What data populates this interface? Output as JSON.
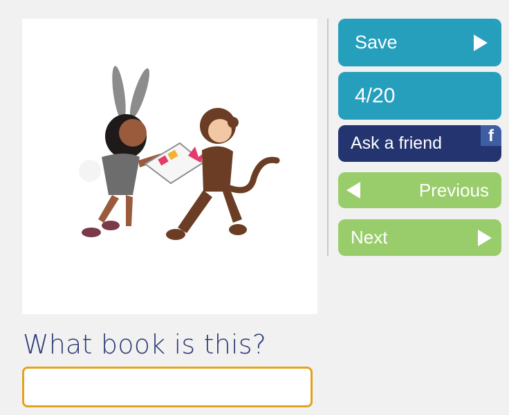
{
  "buttons": {
    "save_label": "Save",
    "progress_label": "4/20",
    "ask_label": "Ask a friend",
    "facebook_glyph": "f",
    "previous_label": "Previous",
    "next_label": "Next"
  },
  "question": {
    "text": "What book is this?"
  },
  "answer": {
    "value": "",
    "placeholder": ""
  },
  "colors": {
    "accent_blue": "#269fbd",
    "navy": "#233471",
    "green": "#99cd6b",
    "input_border": "#e2a31c",
    "question_text": "#2c3a74"
  }
}
